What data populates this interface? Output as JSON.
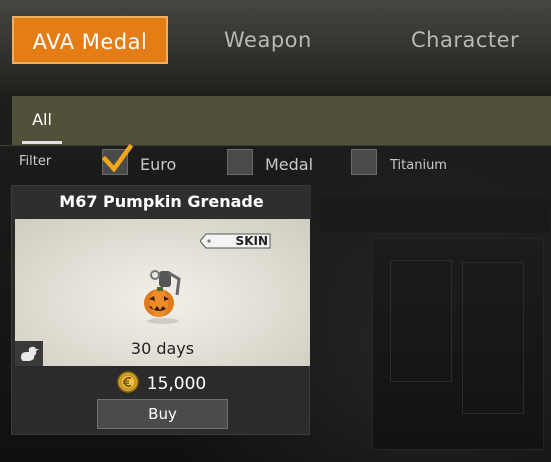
{
  "top_tabs": {
    "ava_medal": "AVA Medal",
    "weapon": "Weapon",
    "character": "Character"
  },
  "sub_tabs": {
    "all": "All"
  },
  "filter": {
    "label": "Filter",
    "options": [
      {
        "label": "Euro",
        "checked": true
      },
      {
        "label": "Medal",
        "checked": false
      },
      {
        "label": "Titanium",
        "checked": false
      }
    ]
  },
  "item": {
    "name": "M67 Pumpkin Grenade",
    "badge": "SKIN",
    "duration": "30 days",
    "price": "15,000",
    "currency_icon": "euro-coin-icon",
    "buy_label": "Buy"
  },
  "colors": {
    "accent": "#e57d16",
    "subbar": "#54533a"
  }
}
